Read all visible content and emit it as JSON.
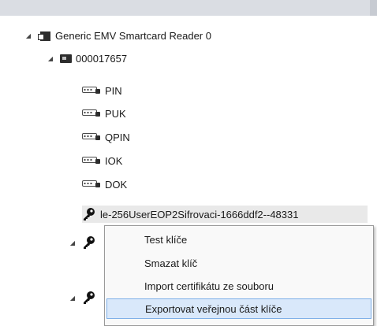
{
  "tree": {
    "reader": {
      "label": "Generic EMV Smartcard Reader 0",
      "expander": "◢"
    },
    "card": {
      "label": "000017657",
      "expander": "◢"
    },
    "objects": [
      {
        "label": "PIN",
        "icon": "pin-icon"
      },
      {
        "label": "PUK",
        "icon": "pin-icon"
      },
      {
        "label": "QPIN",
        "icon": "pin-icon"
      },
      {
        "label": "IOK",
        "icon": "pin-icon"
      },
      {
        "label": "DOK",
        "icon": "pin-icon"
      }
    ],
    "key": {
      "label": "le-256UserEOP2Sifrovaci-1666ddf2--48331",
      "icon": "key-icon"
    },
    "collapsed_expanders": [
      "◢",
      "◢"
    ]
  },
  "context_menu": {
    "items": [
      {
        "label": "Test klíče"
      },
      {
        "label": "Smazat klíč"
      },
      {
        "label": "Import certifikátu ze souboru"
      },
      {
        "label": "Exportovat veřejnou část klíče",
        "active": true
      }
    ]
  }
}
